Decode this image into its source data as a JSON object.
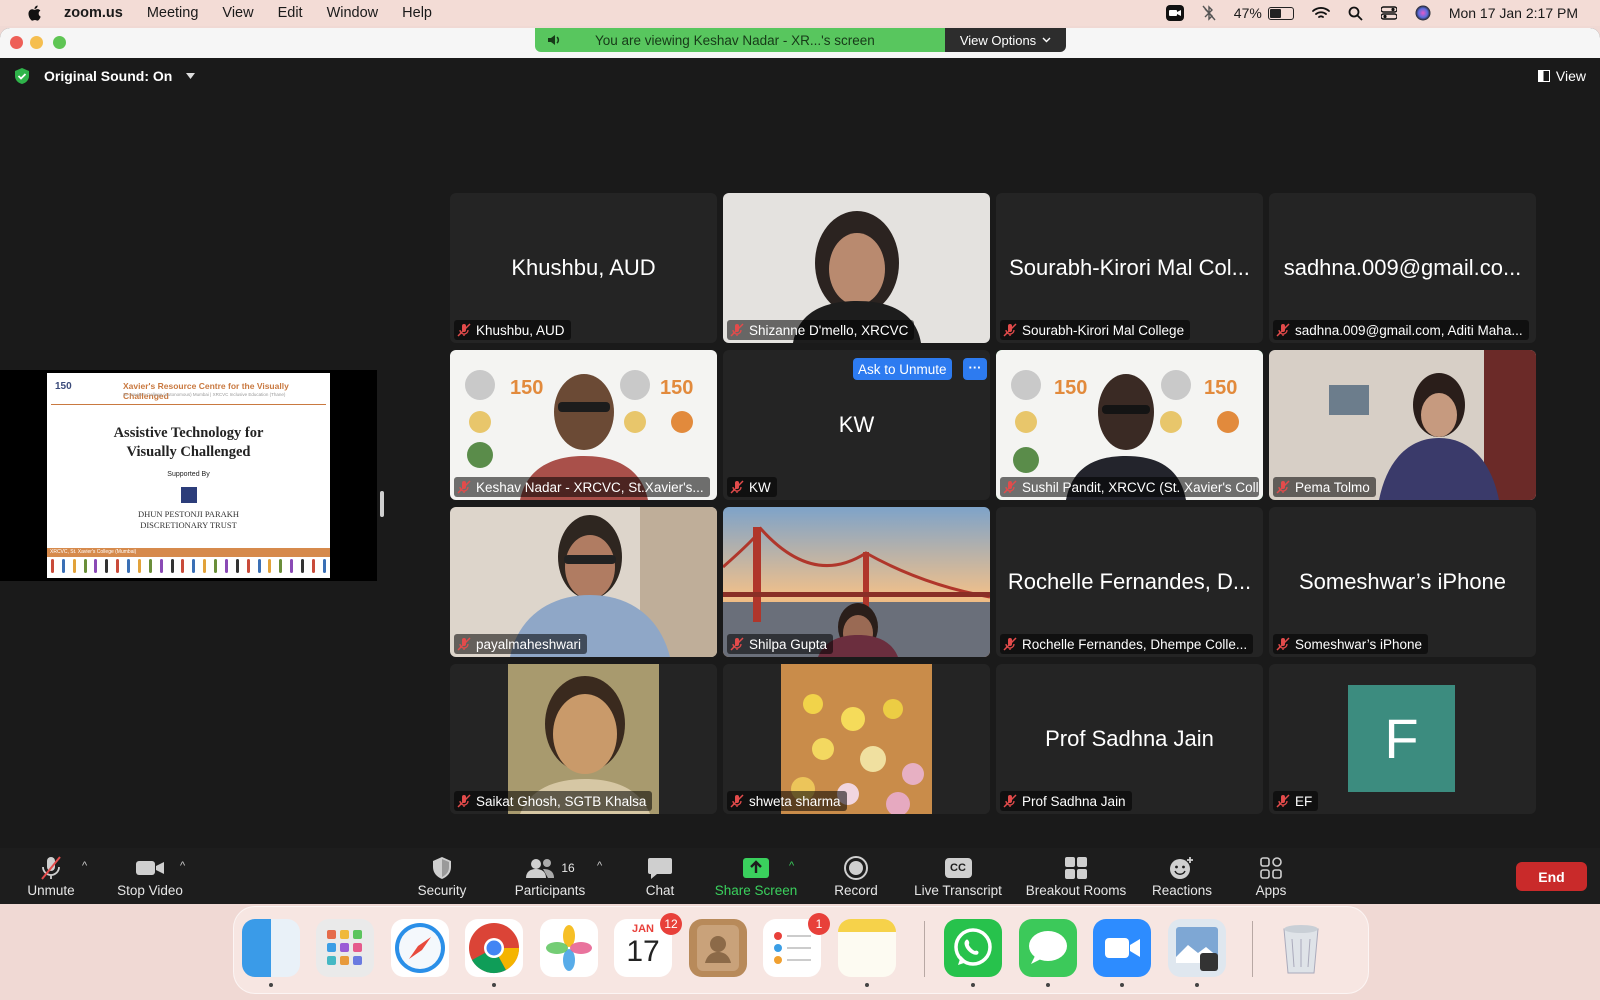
{
  "menubar": {
    "app_name": "zoom.us",
    "menus": [
      "Meeting",
      "View",
      "Edit",
      "Window",
      "Help"
    ],
    "battery_percent": "47%",
    "battery_level": 0.47,
    "clock": "Mon 17 Jan  2:17 PM"
  },
  "window": {
    "viewing_banner": "You are viewing Keshav Nadar - XR...'s screen",
    "view_options_label": "View Options",
    "original_sound_label": "Original Sound: On",
    "view_label": "View"
  },
  "shared_slide": {
    "org_name": "Xavier's Resource Centre for the Visually Challenged",
    "org_sub": "St. Xavier's College (Autonomous) Mumbai | XRCVC Inclusive Education (Thane)",
    "logo_text": "150",
    "title_line1": "Assistive Technology for",
    "title_line2": "Visually Challenged",
    "supported_by": "Supported By",
    "trust_line1": "DHUN PESTONJI PARAKH",
    "trust_line2": "DISCRETIONARY TRUST",
    "footer": "XRCVC, St. Xavier's College (Mumbai)"
  },
  "participants": [
    {
      "big_name": "Khushbu, AUD",
      "label": "Khushbu, AUD"
    },
    {
      "big_name": "",
      "label": "Shizanne D'mello, XRCVC"
    },
    {
      "big_name": "Sourabh-Kirori Mal Col...",
      "label": "Sourabh-Kirori Mal College"
    },
    {
      "big_name": "sadhna.009@gmail.co...",
      "label": "sadhna.009@gmail.com, Aditi Maha..."
    },
    {
      "big_name": "",
      "label": "Keshav Nadar - XRCVC, St.Xavier's..."
    },
    {
      "big_name": "KW",
      "label": "KW"
    },
    {
      "big_name": "",
      "label": "Sushil Pandit, XRCVC (St. Xavier's Coll..."
    },
    {
      "big_name": "",
      "label": "Pema Tolmo"
    },
    {
      "big_name": "",
      "label": "payalmaheshwari"
    },
    {
      "big_name": "",
      "label": "Shilpa Gupta"
    },
    {
      "big_name": "Rochelle Fernandes, D...",
      "label": "Rochelle Fernandes, Dhempe Colle..."
    },
    {
      "big_name": "Someshwar’s iPhone",
      "label": "Someshwar’s iPhone"
    },
    {
      "big_name": "",
      "label": "Saikat Ghosh, SGTB Khalsa"
    },
    {
      "big_name": "",
      "label": "shweta sharma"
    },
    {
      "big_name": "Prof Sadhna Jain",
      "label": "Prof Sadhna Jain"
    },
    {
      "big_name": "F",
      "label": "EF"
    }
  ],
  "kw_tile": {
    "ask_to_unmute": "Ask to Unmute",
    "more": "···"
  },
  "toolbar": {
    "unmute": "Unmute",
    "stop_video": "Stop Video",
    "security": "Security",
    "participants": "Participants",
    "participant_count": "16",
    "chat": "Chat",
    "share_screen": "Share Screen",
    "record": "Record",
    "live_transcript": "Live Transcript",
    "live_transcript_icon": "CC",
    "breakout_rooms": "Breakout Rooms",
    "reactions": "Reactions",
    "apps": "Apps",
    "end": "End"
  },
  "dock": {
    "calendar_month": "JAN",
    "calendar_day": "17",
    "calendar_badge": "12",
    "reminders_badge": "1"
  },
  "colors": {
    "share_green": "#3ad05d",
    "end_red": "#c92a2a",
    "ask_blue": "#2d7bf0",
    "active_speaker": "#2fd05c"
  }
}
